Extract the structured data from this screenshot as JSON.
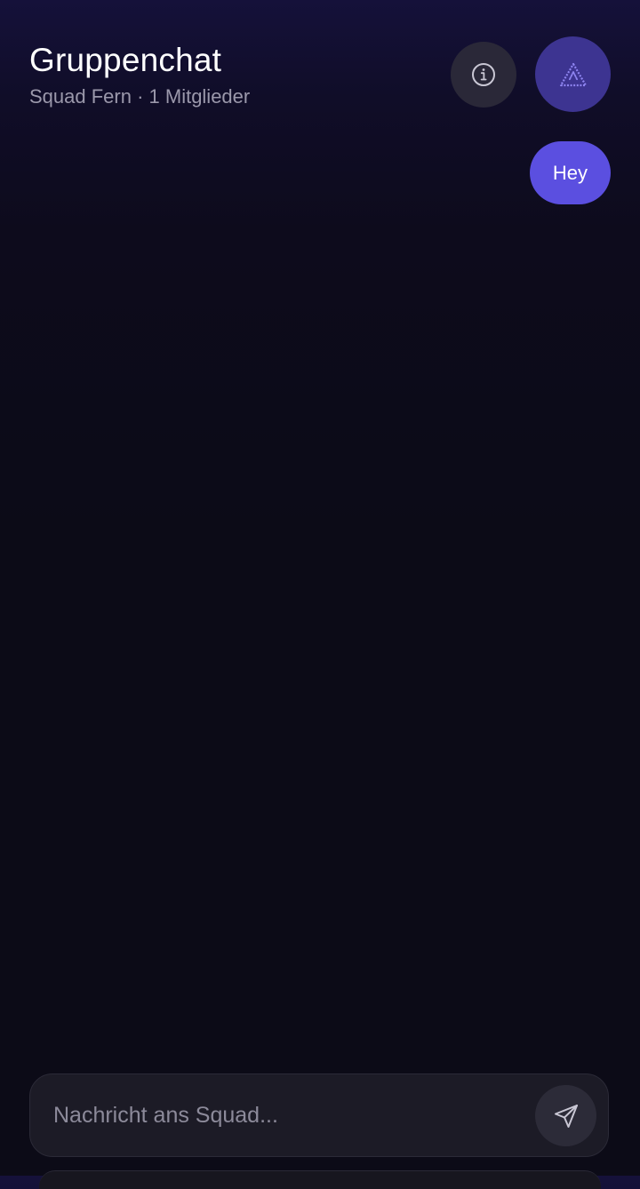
{
  "header": {
    "title": "Gruppenchat",
    "subtitle": "Squad Fern · 1 Mitglieder",
    "info_icon": "info-circle-icon",
    "profile_icon": "triangle-logo-icon"
  },
  "messages": [
    {
      "text": "Hey",
      "from": "me"
    }
  ],
  "composer": {
    "placeholder": "Nachricht ans Squad...",
    "value": "",
    "send_icon": "paper-plane-icon"
  },
  "colors": {
    "accent": "#5b4fe0",
    "profile_bg": "#3d3491",
    "background": "#0c0b17",
    "muted_text": "#9b98ab"
  }
}
